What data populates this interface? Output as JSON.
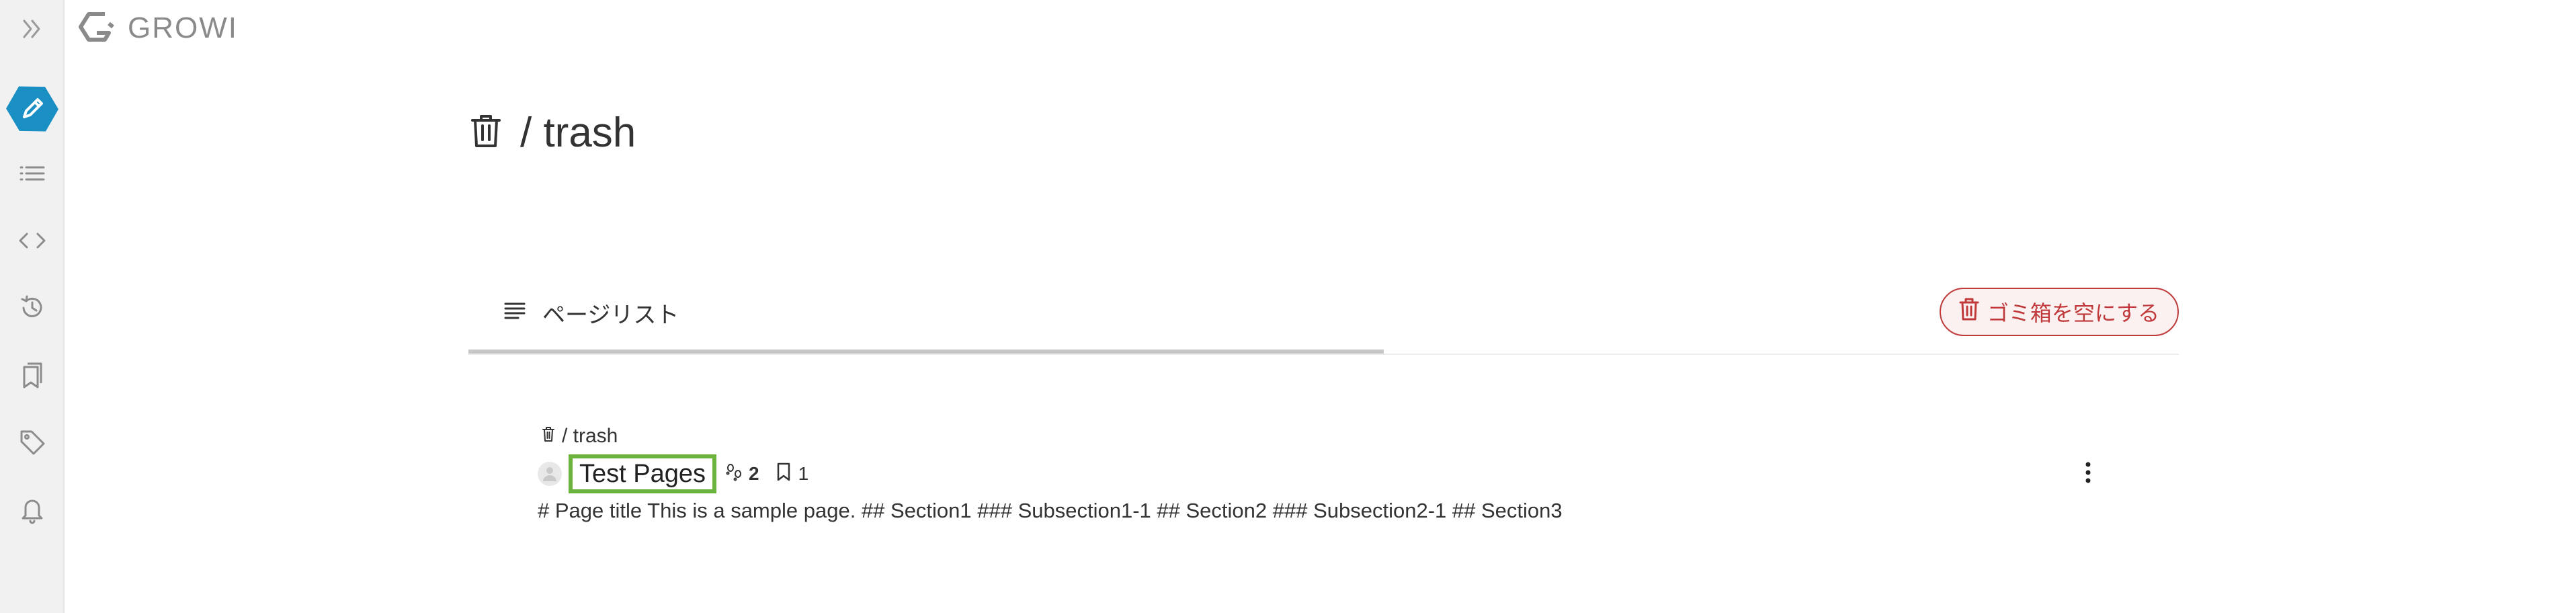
{
  "header": {
    "logo_text": "GROWI"
  },
  "sidebar": {
    "expand_icon": "double-chevron-right-icon",
    "items": [
      {
        "name": "edit",
        "icon": "pencil-icon",
        "active": true
      },
      {
        "name": "page-tree",
        "icon": "list-icon"
      },
      {
        "name": "custom-sidebar",
        "icon": "code-icon"
      },
      {
        "name": "recent-changes",
        "icon": "history-icon"
      },
      {
        "name": "bookmarks",
        "icon": "bookmarks-icon"
      },
      {
        "name": "tags",
        "icon": "tag-icon"
      },
      {
        "name": "notifications",
        "icon": "bell-icon"
      }
    ],
    "accent_color": "#1a8fc4"
  },
  "page": {
    "title": "/ trash"
  },
  "tabs": {
    "page_list_label": "ページリスト",
    "empty_trash_label": "ゴミ箱を空にする",
    "danger_color": "#c0393b"
  },
  "list": {
    "items": [
      {
        "path": "/ trash",
        "title": "Test Pages",
        "seen_count": "2",
        "bookmark_count": "1",
        "excerpt": "# Page title This is a sample page. ## Section1 ### Subsection1-1 ## Section2 ### Subsection2-1 ## Section3",
        "highlight_color": "#6cb33e"
      }
    ]
  }
}
